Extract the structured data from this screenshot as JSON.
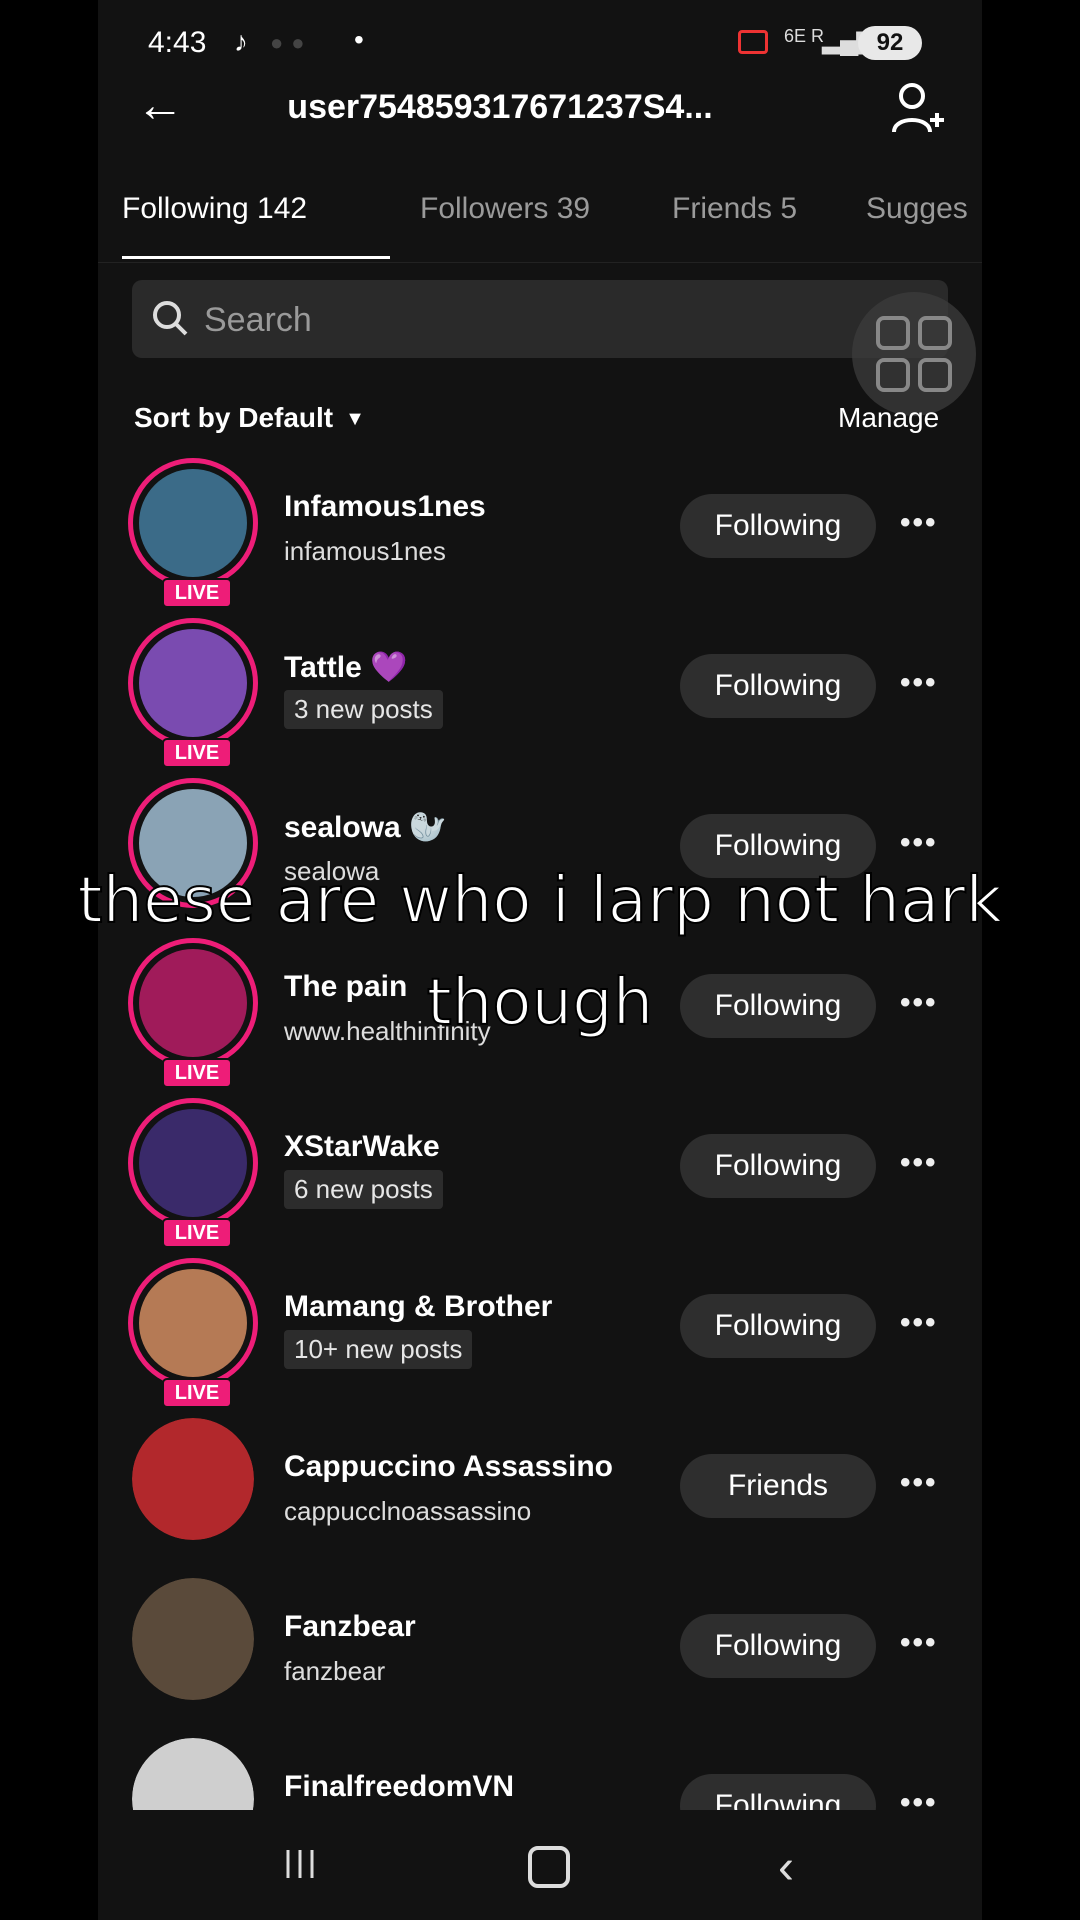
{
  "status": {
    "time": "4:43",
    "battery": "92",
    "network": "6E R"
  },
  "header": {
    "title": "user754859317671237S4...",
    "back_icon": "arrow-left-icon",
    "add_icon": "add-user-icon"
  },
  "tabs": [
    {
      "label": "Following 142"
    },
    {
      "label": "Followers 39"
    },
    {
      "label": "Friends 5"
    },
    {
      "label": "Sugges"
    }
  ],
  "search": {
    "placeholder": "Search"
  },
  "sort": {
    "label": "Sort by Default"
  },
  "manage": {
    "label": "Manage"
  },
  "live_label": "LIVE",
  "accounts": [
    {
      "name": "Infamous1nes",
      "sub": "infamous1nes",
      "sub_is_pill": false,
      "button": "Following",
      "live": true,
      "color": "#3b6b88"
    },
    {
      "name": "Tattle 💜",
      "sub": "3 new posts",
      "sub_is_pill": true,
      "button": "Following",
      "live": true,
      "color": "#7a4bb0"
    },
    {
      "name": "sealowa 🦭",
      "sub": "sealowa",
      "sub_is_pill": false,
      "button": "Following",
      "live": false,
      "color": "#8aa3b5"
    },
    {
      "name": "The pain",
      "sub": "www.healthinfinity",
      "sub_is_pill": false,
      "button": "Following",
      "live": true,
      "color": "#a01b5a"
    },
    {
      "name": "XStarWake",
      "sub": "6 new posts",
      "sub_is_pill": true,
      "button": "Following",
      "live": true,
      "color": "#3a2a6a"
    },
    {
      "name": "Mamang & Brother",
      "sub": "10+ new posts",
      "sub_is_pill": true,
      "button": "Following",
      "live": true,
      "color": "#b57a55"
    },
    {
      "name": "Cappuccino Assassino",
      "sub": "cappucclnoassassino",
      "sub_is_pill": false,
      "button": "Friends",
      "live": false,
      "color": "#b2282c"
    },
    {
      "name": "Fanzbear",
      "sub": "fanzbear",
      "sub_is_pill": false,
      "button": "Following",
      "live": false,
      "color": "#5a4a3a"
    },
    {
      "name": "FinalfreedomVN",
      "sub": "",
      "sub_is_pill": false,
      "button": "Following",
      "live": false,
      "color": "#cfcfcf"
    }
  ],
  "caption": {
    "line1": "these are who i larp not hark",
    "line2": "though"
  }
}
